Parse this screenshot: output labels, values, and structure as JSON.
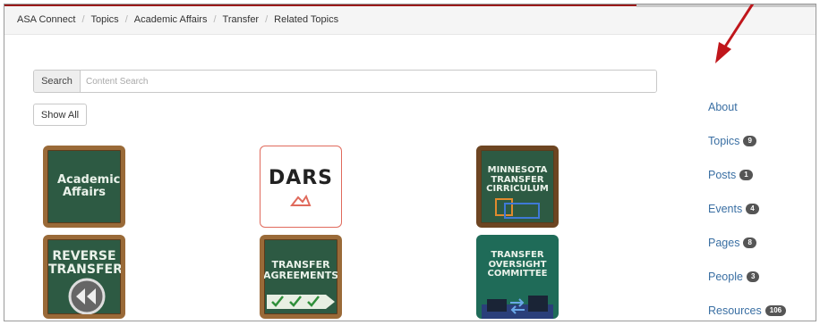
{
  "breadcrumb": [
    "ASA Connect",
    "Topics",
    "Academic Affairs",
    "Transfer",
    "Related Topics"
  ],
  "search": {
    "label": "Search",
    "placeholder": "Content Search"
  },
  "show_all_label": "Show All",
  "tiles": [
    {
      "label": "Academic Affairs"
    },
    {
      "label": "DARS"
    },
    {
      "label": "Minnesota Transfer Cirriculum"
    },
    {
      "label": "Reverse Transfer"
    },
    {
      "label": "Transfer Agreements"
    },
    {
      "label": "Transfer Oversight Committee"
    }
  ],
  "sidebar": {
    "items": [
      {
        "label": "About",
        "count": ""
      },
      {
        "label": "Topics",
        "count": "9"
      },
      {
        "label": "Posts",
        "count": "1"
      },
      {
        "label": "Events",
        "count": "4"
      },
      {
        "label": "Pages",
        "count": "8"
      },
      {
        "label": "People",
        "count": "3"
      },
      {
        "label": "Resources",
        "count": "106"
      }
    ]
  },
  "colors": {
    "link": "#3a6fa3",
    "chalkboard": "#2d5a43",
    "frame_wood": "#9a6a38",
    "annotation_arrow": "#c0161b",
    "dars_border": "#e06a5c"
  }
}
